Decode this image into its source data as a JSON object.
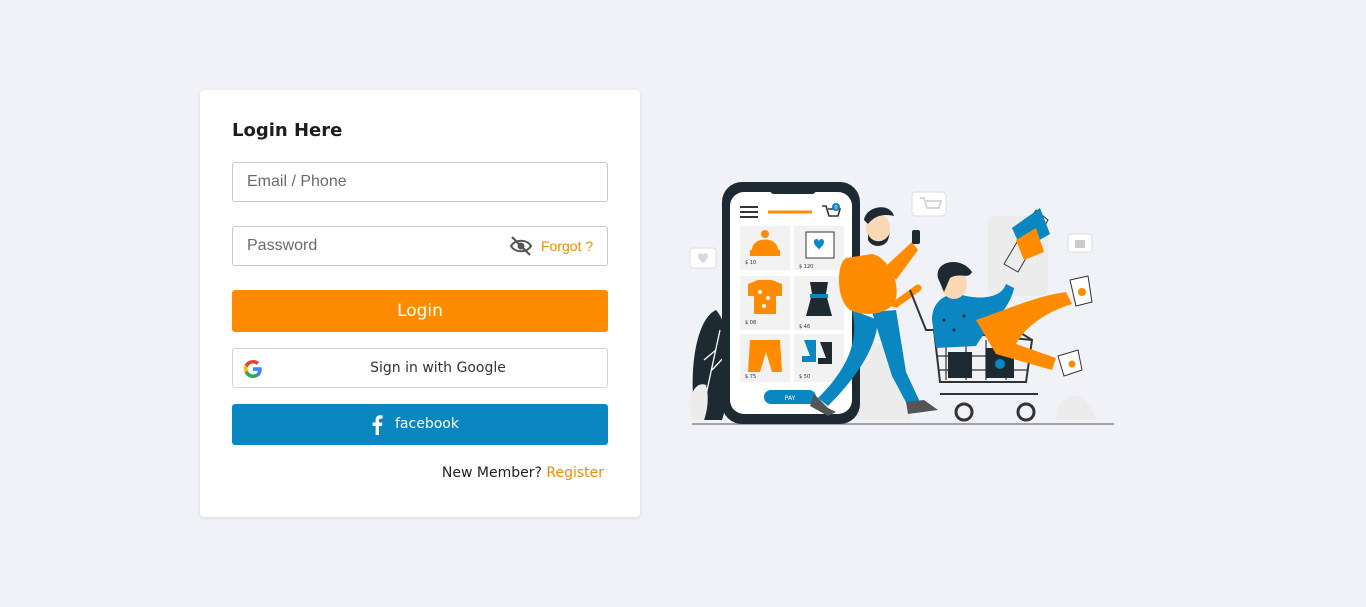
{
  "login": {
    "title": "Login Here",
    "email_placeholder": "Email / Phone",
    "password_placeholder": "Password",
    "forgot_label": "Forgot ?",
    "login_label": "Login",
    "google_label": "Sign in with Google",
    "facebook_label": "facebook",
    "new_member_text": "New Member?",
    "register_label": "Register"
  },
  "illustration": {
    "prices": [
      "$ 10",
      "$ 120",
      "$ 08",
      "$ 46",
      "$ 75",
      "$ 50"
    ],
    "pay_label": "PAY",
    "cart_badge": "0"
  },
  "colors": {
    "accent": "#ff8c00",
    "link": "#f18a00",
    "facebook": "#0a86c1",
    "background": "#f0f2f7"
  },
  "icons": [
    "eye-off-icon",
    "google-icon",
    "facebook-icon",
    "cart-icon",
    "menu-icon"
  ]
}
